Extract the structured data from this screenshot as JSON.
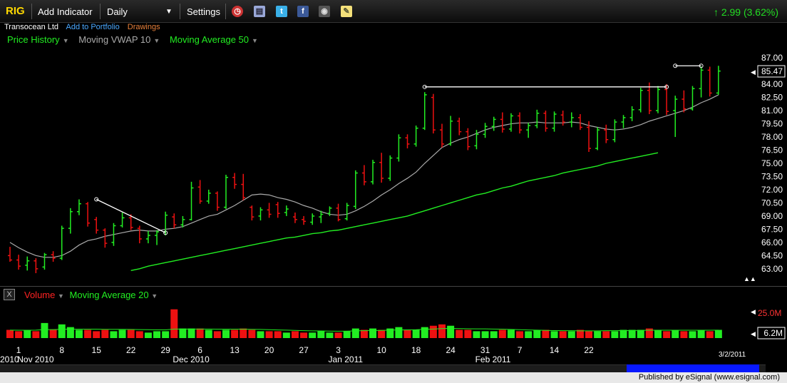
{
  "toolbar": {
    "symbol": "RIG",
    "add_indicator": "Add Indicator",
    "interval": "Daily",
    "settings": "Settings",
    "change": "2.99 (3.62%)"
  },
  "subheader": {
    "company": "Transocean Ltd",
    "add_to_portfolio": "Add to Portfolio",
    "drawings": "Drawings"
  },
  "indicators": [
    {
      "label": "Price History",
      "color": "#22ee22"
    },
    {
      "label": "Moving VWAP 10",
      "color": "#aaaaaa"
    },
    {
      "label": "Moving Average 50",
      "color": "#22ee22"
    }
  ],
  "volume_legend": {
    "volume": "Volume",
    "ma": "Moving Average 20"
  },
  "footer": {
    "published": "Published by eSignal (www.esignal.com)"
  },
  "chart_data": {
    "type": "bar",
    "price_axis": {
      "ticks": [
        "87.00",
        "85.50",
        "84.00",
        "82.50",
        "81.00",
        "79.50",
        "78.00",
        "76.50",
        "75.00",
        "73.50",
        "72.00",
        "70.50",
        "69.00",
        "67.50",
        "66.00",
        "64.50",
        "63.00"
      ],
      "range": [
        62.5,
        87.5
      ],
      "last_price": "85.47"
    },
    "volume_axis": {
      "top_label": "25.0M",
      "last": "6.2M",
      "range": [
        0,
        25000000
      ]
    },
    "date_labels": [
      {
        "label": "1",
        "idx": 1
      },
      {
        "label": "8",
        "idx": 6
      },
      {
        "label": "15",
        "idx": 10
      },
      {
        "label": "22",
        "idx": 14
      },
      {
        "label": "29",
        "idx": 18
      },
      {
        "label": "6",
        "idx": 22
      },
      {
        "label": "13",
        "idx": 26
      },
      {
        "label": "20",
        "idx": 30
      },
      {
        "label": "27",
        "idx": 34
      },
      {
        "label": "3",
        "idx": 38
      },
      {
        "label": "10",
        "idx": 43
      },
      {
        "label": "18",
        "idx": 47
      },
      {
        "label": "24",
        "idx": 51
      },
      {
        "label": "31",
        "idx": 55
      },
      {
        "label": "7",
        "idx": 59
      },
      {
        "label": "14",
        "idx": 63
      },
      {
        "label": "22",
        "idx": 67
      }
    ],
    "month_labels": [
      {
        "label": "2010",
        "idx": 0
      },
      {
        "label": "Nov 2010",
        "idx": 2
      },
      {
        "label": "Dec 2010",
        "idx": 20
      },
      {
        "label": "Jan 2011",
        "idx": 38
      },
      {
        "label": "Feb 2011",
        "idx": 55
      }
    ],
    "last_date": "3/2/2011",
    "bars": [
      {
        "o": 64.5,
        "h": 65.5,
        "l": 63.8,
        "c": 64.0,
        "v": 6
      },
      {
        "o": 64.0,
        "h": 64.6,
        "l": 62.9,
        "c": 63.3,
        "v": 5
      },
      {
        "o": 63.4,
        "h": 64.4,
        "l": 62.8,
        "c": 63.9,
        "v": 6
      },
      {
        "o": 63.9,
        "h": 64.2,
        "l": 62.5,
        "c": 63.0,
        "v": 5
      },
      {
        "o": 63.2,
        "h": 64.8,
        "l": 62.9,
        "c": 64.6,
        "v": 11
      },
      {
        "o": 64.6,
        "h": 65.0,
        "l": 63.8,
        "c": 64.2,
        "v": 6
      },
      {
        "o": 64.2,
        "h": 67.9,
        "l": 64.0,
        "c": 67.6,
        "v": 10
      },
      {
        "o": 67.6,
        "h": 69.9,
        "l": 67.0,
        "c": 69.5,
        "v": 8
      },
      {
        "o": 69.5,
        "h": 70.9,
        "l": 69.1,
        "c": 70.4,
        "v": 6
      },
      {
        "o": 70.4,
        "h": 70.6,
        "l": 67.8,
        "c": 68.2,
        "v": 6
      },
      {
        "o": 68.6,
        "h": 68.9,
        "l": 67.0,
        "c": 67.4,
        "v": 5
      },
      {
        "o": 67.4,
        "h": 67.6,
        "l": 65.4,
        "c": 65.9,
        "v": 6
      },
      {
        "o": 66.0,
        "h": 68.2,
        "l": 65.6,
        "c": 67.9,
        "v": 5
      },
      {
        "o": 67.9,
        "h": 69.4,
        "l": 67.7,
        "c": 68.8,
        "v": 6
      },
      {
        "o": 68.8,
        "h": 69.2,
        "l": 67.4,
        "c": 67.7,
        "v": 6
      },
      {
        "o": 67.6,
        "h": 67.9,
        "l": 65.9,
        "c": 66.4,
        "v": 5
      },
      {
        "o": 66.4,
        "h": 67.3,
        "l": 65.9,
        "c": 66.8,
        "v": 4
      },
      {
        "o": 66.8,
        "h": 67.4,
        "l": 65.7,
        "c": 67.2,
        "v": 5
      },
      {
        "o": 67.2,
        "h": 69.5,
        "l": 66.8,
        "c": 69.1,
        "v": 5
      },
      {
        "o": 68.9,
        "h": 69.3,
        "l": 67.6,
        "c": 68.0,
        "v": 21
      },
      {
        "o": 68.0,
        "h": 69.0,
        "l": 67.7,
        "c": 68.6,
        "v": 7
      },
      {
        "o": 68.6,
        "h": 72.9,
        "l": 68.5,
        "c": 72.2,
        "v": 7
      },
      {
        "o": 72.3,
        "h": 73.1,
        "l": 70.4,
        "c": 70.7,
        "v": 7
      },
      {
        "o": 70.7,
        "h": 72.0,
        "l": 70.4,
        "c": 71.6,
        "v": 6
      },
      {
        "o": 71.6,
        "h": 71.8,
        "l": 69.6,
        "c": 70.0,
        "v": 5
      },
      {
        "o": 70.0,
        "h": 73.7,
        "l": 69.8,
        "c": 73.4,
        "v": 6
      },
      {
        "o": 73.4,
        "h": 73.9,
        "l": 72.1,
        "c": 72.6,
        "v": 6
      },
      {
        "o": 72.6,
        "h": 73.8,
        "l": 70.8,
        "c": 71.1,
        "v": 7
      },
      {
        "o": 70.0,
        "h": 70.2,
        "l": 68.5,
        "c": 68.9,
        "v": 6
      },
      {
        "o": 69.0,
        "h": 70.0,
        "l": 68.5,
        "c": 69.7,
        "v": 5
      },
      {
        "o": 69.7,
        "h": 70.5,
        "l": 68.8,
        "c": 69.2,
        "v": 5
      },
      {
        "o": 70.3,
        "h": 70.6,
        "l": 68.8,
        "c": 69.3,
        "v": 5
      },
      {
        "o": 69.4,
        "h": 70.2,
        "l": 69.0,
        "c": 69.8,
        "v": 4
      },
      {
        "o": 68.9,
        "h": 69.4,
        "l": 68.2,
        "c": 68.6,
        "v": 5
      },
      {
        "o": 68.6,
        "h": 69.0,
        "l": 68.0,
        "c": 68.4,
        "v": 4
      },
      {
        "o": 68.3,
        "h": 69.3,
        "l": 68.0,
        "c": 69.0,
        "v": 4
      },
      {
        "o": 68.9,
        "h": 69.6,
        "l": 68.2,
        "c": 69.2,
        "v": 5
      },
      {
        "o": 69.3,
        "h": 70.1,
        "l": 69.0,
        "c": 69.9,
        "v": 4
      },
      {
        "o": 69.9,
        "h": 70.4,
        "l": 68.4,
        "c": 68.6,
        "v": 4
      },
      {
        "o": 68.7,
        "h": 70.5,
        "l": 68.5,
        "c": 70.2,
        "v": 5
      },
      {
        "o": 70.1,
        "h": 74.2,
        "l": 69.8,
        "c": 73.9,
        "v": 7
      },
      {
        "o": 73.9,
        "h": 74.8,
        "l": 72.5,
        "c": 72.9,
        "v": 6
      },
      {
        "o": 72.9,
        "h": 75.4,
        "l": 72.6,
        "c": 75.1,
        "v": 7
      },
      {
        "o": 75.1,
        "h": 76.2,
        "l": 72.8,
        "c": 73.3,
        "v": 6
      },
      {
        "o": 73.3,
        "h": 75.9,
        "l": 73.0,
        "c": 75.6,
        "v": 7
      },
      {
        "o": 75.6,
        "h": 78.3,
        "l": 75.2,
        "c": 77.9,
        "v": 8
      },
      {
        "o": 77.9,
        "h": 78.3,
        "l": 76.7,
        "c": 77.2,
        "v": 6
      },
      {
        "o": 77.2,
        "h": 79.3,
        "l": 76.9,
        "c": 79.0,
        "v": 6
      },
      {
        "o": 79.0,
        "h": 83.1,
        "l": 78.8,
        "c": 82.8,
        "v": 8
      },
      {
        "o": 82.5,
        "h": 82.9,
        "l": 78.4,
        "c": 78.8,
        "v": 9
      },
      {
        "o": 78.8,
        "h": 79.5,
        "l": 76.8,
        "c": 77.2,
        "v": 10
      },
      {
        "o": 77.2,
        "h": 80.4,
        "l": 77.0,
        "c": 79.8,
        "v": 9
      },
      {
        "o": 79.8,
        "h": 80.2,
        "l": 78.2,
        "c": 78.6,
        "v": 6
      },
      {
        "o": 78.6,
        "h": 79.0,
        "l": 76.5,
        "c": 76.9,
        "v": 6
      },
      {
        "o": 77.0,
        "h": 78.8,
        "l": 76.6,
        "c": 78.3,
        "v": 5
      },
      {
        "o": 78.3,
        "h": 79.6,
        "l": 77.9,
        "c": 79.2,
        "v": 5
      },
      {
        "o": 79.2,
        "h": 80.3,
        "l": 78.7,
        "c": 80.0,
        "v": 5
      },
      {
        "o": 80.0,
        "h": 80.8,
        "l": 78.5,
        "c": 78.9,
        "v": 6
      },
      {
        "o": 78.9,
        "h": 80.7,
        "l": 78.6,
        "c": 80.4,
        "v": 6
      },
      {
        "o": 80.4,
        "h": 80.8,
        "l": 78.4,
        "c": 78.8,
        "v": 5
      },
      {
        "o": 78.8,
        "h": 79.6,
        "l": 77.9,
        "c": 79.3,
        "v": 5
      },
      {
        "o": 79.3,
        "h": 81.1,
        "l": 79.0,
        "c": 80.7,
        "v": 6
      },
      {
        "o": 80.7,
        "h": 81.0,
        "l": 78.6,
        "c": 79.0,
        "v": 6
      },
      {
        "o": 79.0,
        "h": 80.9,
        "l": 78.6,
        "c": 80.6,
        "v": 5
      },
      {
        "o": 80.5,
        "h": 81.0,
        "l": 79.3,
        "c": 79.7,
        "v": 5
      },
      {
        "o": 79.7,
        "h": 80.8,
        "l": 79.1,
        "c": 80.2,
        "v": 5
      },
      {
        "o": 80.2,
        "h": 80.6,
        "l": 78.8,
        "c": 79.1,
        "v": 6
      },
      {
        "o": 79.1,
        "h": 79.8,
        "l": 76.3,
        "c": 76.7,
        "v": 5
      },
      {
        "o": 76.7,
        "h": 79.1,
        "l": 76.5,
        "c": 78.8,
        "v": 5
      },
      {
        "o": 78.8,
        "h": 79.4,
        "l": 77.3,
        "c": 77.7,
        "v": 5
      },
      {
        "o": 77.7,
        "h": 80.0,
        "l": 77.4,
        "c": 79.7,
        "v": 5
      },
      {
        "o": 79.7,
        "h": 80.5,
        "l": 79.0,
        "c": 80.2,
        "v": 6
      },
      {
        "o": 80.2,
        "h": 81.5,
        "l": 79.8,
        "c": 81.1,
        "v": 6
      },
      {
        "o": 81.1,
        "h": 83.6,
        "l": 80.8,
        "c": 83.3,
        "v": 6
      },
      {
        "o": 83.3,
        "h": 84.2,
        "l": 80.6,
        "c": 81.0,
        "v": 7
      },
      {
        "o": 81.0,
        "h": 83.8,
        "l": 80.7,
        "c": 83.4,
        "v": 6
      },
      {
        "o": 83.4,
        "h": 84.0,
        "l": 80.5,
        "c": 80.9,
        "v": 5
      },
      {
        "o": 81.0,
        "h": 82.7,
        "l": 78.0,
        "c": 82.3,
        "v": 6
      },
      {
        "o": 82.3,
        "h": 83.3,
        "l": 80.8,
        "c": 81.2,
        "v": 5
      },
      {
        "o": 81.2,
        "h": 83.8,
        "l": 81.0,
        "c": 83.5,
        "v": 5
      },
      {
        "o": 83.5,
        "h": 86.0,
        "l": 82.5,
        "c": 85.6,
        "v": 6
      },
      {
        "o": 85.6,
        "h": 86.0,
        "l": 82.6,
        "c": 83.0,
        "v": 5
      },
      {
        "o": 83.0,
        "h": 86.1,
        "l": 82.8,
        "c": 85.5,
        "v": 6
      }
    ],
    "vwap10": [
      66.0,
      65.4,
      64.9,
      64.5,
      64.3,
      64.3,
      64.5,
      65.0,
      65.7,
      66.2,
      66.4,
      66.7,
      66.9,
      67.1,
      67.3,
      67.4,
      67.3,
      67.3,
      67.5,
      67.6,
      67.8,
      68.2,
      68.6,
      69.0,
      69.2,
      69.7,
      70.2,
      70.8,
      71.4,
      71.5,
      71.4,
      71.1,
      70.9,
      70.6,
      70.2,
      69.9,
      69.5,
      69.2,
      69.1,
      69.2,
      69.6,
      70.1,
      70.7,
      71.4,
      72.0,
      72.7,
      73.3,
      74.0,
      75.0,
      75.9,
      76.8,
      77.3,
      77.7,
      78.0,
      78.4,
      78.8,
      79.1,
      79.3,
      79.5,
      79.6,
      79.6,
      79.7,
      79.6,
      79.6,
      79.6,
      79.7,
      79.6,
      79.3,
      79.1,
      78.9,
      78.8,
      78.9,
      79.1,
      79.4,
      79.8,
      80.1,
      80.4,
      80.7,
      81.0,
      81.4,
      81.9,
      82.3,
      82.8
    ],
    "ma50": [
      null,
      null,
      null,
      null,
      null,
      null,
      null,
      null,
      null,
      null,
      null,
      null,
      null,
      null,
      62.8,
      63.0,
      63.3,
      63.5,
      63.7,
      63.9,
      64.1,
      64.3,
      64.5,
      64.7,
      64.9,
      65.1,
      65.3,
      65.5,
      65.7,
      65.9,
      66.1,
      66.3,
      66.5,
      66.6,
      66.8,
      67.0,
      67.1,
      67.3,
      67.4,
      67.6,
      67.8,
      68.0,
      68.2,
      68.4,
      68.6,
      68.8,
      69.0,
      69.3,
      69.6,
      69.9,
      70.2,
      70.5,
      70.8,
      71.1,
      71.4,
      71.6,
      71.9,
      72.2,
      72.4,
      72.7,
      73.0,
      73.2,
      73.4,
      73.6,
      73.9,
      74.1,
      74.3,
      74.5,
      74.7,
      75.0,
      75.2,
      75.4,
      75.6,
      75.8,
      76.0,
      76.2
    ],
    "vol_ma20": [
      5.8,
      5.7,
      5.7,
      5.8,
      6.2,
      6.2,
      6.4,
      6.5,
      6.5,
      6.5,
      6.5,
      6.4,
      6.4,
      6.4,
      6.3,
      6.2,
      6.1,
      6.0,
      6.0,
      6.6,
      6.6,
      6.6,
      6.6,
      6.6,
      6.5,
      6.5,
      6.5,
      6.5,
      6.4,
      6.3,
      6.1,
      5.9,
      5.8,
      5.6,
      5.4,
      5.3,
      5.2,
      5.1,
      5.0,
      5.1,
      5.3,
      5.4,
      5.5,
      5.6,
      5.8,
      5.9,
      6.0,
      6.1,
      6.4,
      6.6,
      6.9,
      7.0,
      6.9,
      6.8,
      6.7,
      6.7,
      6.6,
      6.5,
      6.3,
      6.1,
      5.9,
      5.8,
      5.6,
      5.5,
      5.4,
      5.4,
      5.3,
      5.3,
      5.3,
      5.4,
      5.4,
      5.5,
      5.5,
      5.6,
      5.7,
      5.7,
      5.7,
      5.7,
      5.7,
      5.7,
      5.7,
      5.7,
      5.8
    ],
    "trendlines": [
      {
        "from_idx": 10,
        "from_price": 70.9,
        "to_idx": 18,
        "to_price": 67.1
      },
      {
        "from_idx": 48,
        "from_price": 83.7,
        "to_idx": 76,
        "to_price": 83.7
      },
      {
        "from_idx": 77,
        "from_price": 86.1,
        "to_idx": 80,
        "to_price": 86.1
      }
    ],
    "colors": {
      "up": "#22ee22",
      "down": "#ee1111",
      "vwap": "#aaaaaa",
      "ma": "#22ee22",
      "trend": "#ffffff",
      "grid": "#2a2a2a"
    }
  }
}
